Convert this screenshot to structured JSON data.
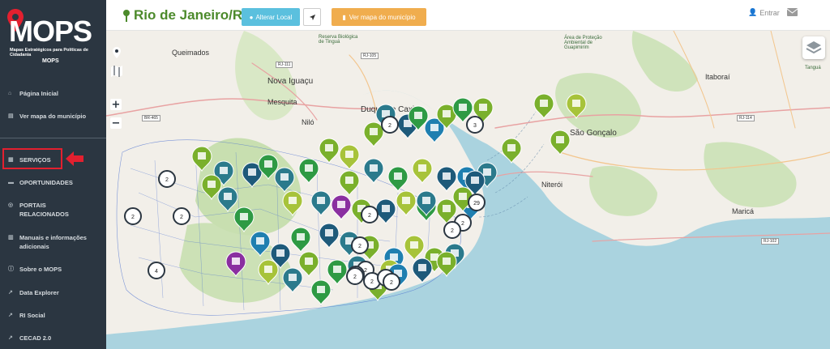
{
  "logo": {
    "title": "MOPS",
    "subtitle": "Mapas Estratégicos para Políticas de Cidadania",
    "small": "MOPS"
  },
  "sidebar": {
    "items": [
      {
        "label": "Página Inicial",
        "icon": "home-icon"
      },
      {
        "label": "Ver mapa do município",
        "icon": "map-icon"
      },
      {
        "label": "SERVIÇOS",
        "icon": "grid-icon"
      },
      {
        "label": "OPORTUNIDADES",
        "icon": "briefcase-icon"
      },
      {
        "label": "PORTAIS RELACIONADOS",
        "icon": "globe-icon"
      },
      {
        "label": "Manuais e informações adicionais",
        "icon": "book-icon"
      },
      {
        "label": "Sobre o MOPS",
        "icon": "info-icon"
      },
      {
        "label": "Data Explorer",
        "icon": "external-link-icon"
      },
      {
        "label": "RI Social",
        "icon": "external-link-icon"
      },
      {
        "label": "CECAD 2.0",
        "icon": "external-link-icon"
      }
    ]
  },
  "topbar": {
    "city": "Rio de Janeiro/RJ",
    "alterar_local": "Alterar Local",
    "ver_mapa": "Ver mapa do município",
    "entrar": "Entrar"
  },
  "map": {
    "places": [
      {
        "name": "Queimados"
      },
      {
        "name": "Nova Iguaçu"
      },
      {
        "name": "Mesquita"
      },
      {
        "name": "Niló"
      },
      {
        "name": "Duque de Caxias"
      },
      {
        "name": "Itaboraí"
      },
      {
        "name": "São Gonçalo"
      },
      {
        "name": "Niterói"
      },
      {
        "name": "Maricá"
      },
      {
        "name": "Tanguá"
      }
    ],
    "roads": [
      "RJ-111",
      "RJ-105",
      "BR-465",
      "RJ-114",
      "RJ-102"
    ],
    "areas": [
      "Área de Proteção Ambiental de Guapimirim",
      "Reserva Biológica de Tinguá",
      "Área de Proteção Ambiental de Guapi-Mirim"
    ],
    "cluster_counts": [
      "2",
      "2",
      "2",
      "4",
      "2",
      "2",
      "2",
      "3",
      "2",
      "2",
      "2",
      "3",
      "29",
      "2",
      "2",
      "2",
      "2"
    ]
  },
  "colors": {
    "sidebar": "#2b3641",
    "highlight": "#e3202f",
    "city": "#4c8a2b",
    "btn_info": "#5bc0de",
    "btn_warning": "#f0ad4e",
    "water": "#aad3df",
    "land": "#f2efe9",
    "green_area": "#c8dfb0"
  }
}
